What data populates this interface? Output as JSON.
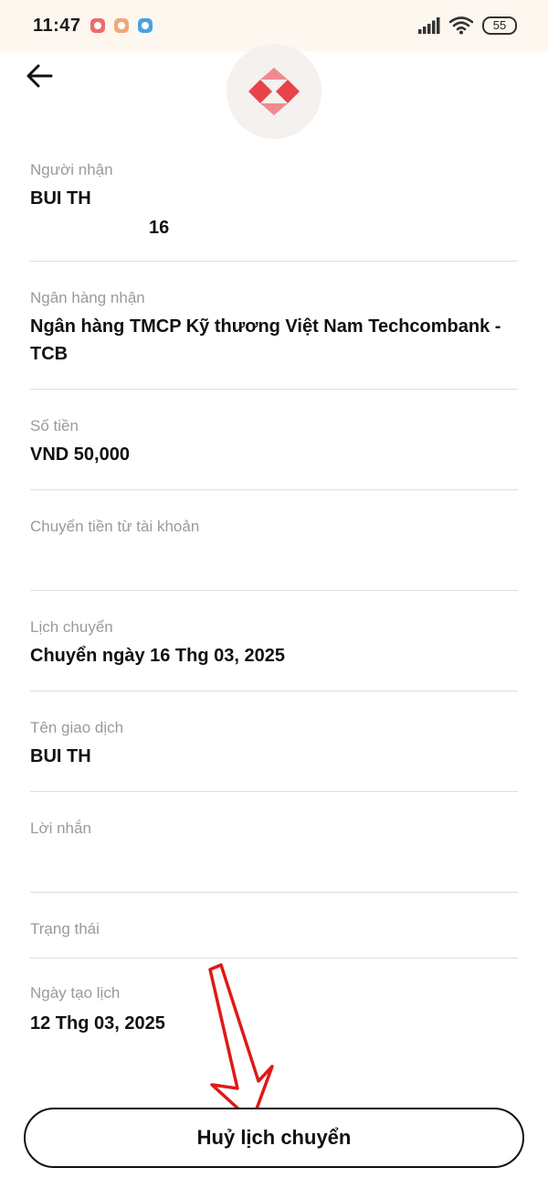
{
  "status_bar": {
    "time": "11:47",
    "battery": "55"
  },
  "fields": {
    "recipient": {
      "label": "Người nhận",
      "name": "BUI TH",
      "account": "16"
    },
    "bank": {
      "label": "Ngân hàng nhận",
      "value": "Ngân hàng TMCP Kỹ thương Việt Nam Techcombank - TCB"
    },
    "amount": {
      "label": "Số tiền",
      "value": "VND 50,000"
    },
    "from_account": {
      "label": "Chuyển tiền từ tài khoản"
    },
    "schedule": {
      "label": "Lịch chuyển",
      "value": "Chuyển ngày 16 Thg 03, 2025"
    },
    "transaction_name": {
      "label": "Tên giao dịch",
      "value": "BUI TH"
    },
    "message": {
      "label": "Lời nhắn"
    },
    "status": {
      "label": "Trạng thái"
    },
    "created_date": {
      "label": "Ngày tạo lịch",
      "value": "12 Thg 03, 2025"
    }
  },
  "actions": {
    "cancel_label": "Huỷ lịch chuyển"
  },
  "colors": {
    "brand": "#e8434b",
    "annotation_arrow": "#e01818",
    "status_bar_bg": "#fdf7f0"
  },
  "icons": [
    "back-arrow-icon",
    "bank-logo-icon",
    "signal-icon",
    "wifi-icon",
    "battery-icon"
  ]
}
